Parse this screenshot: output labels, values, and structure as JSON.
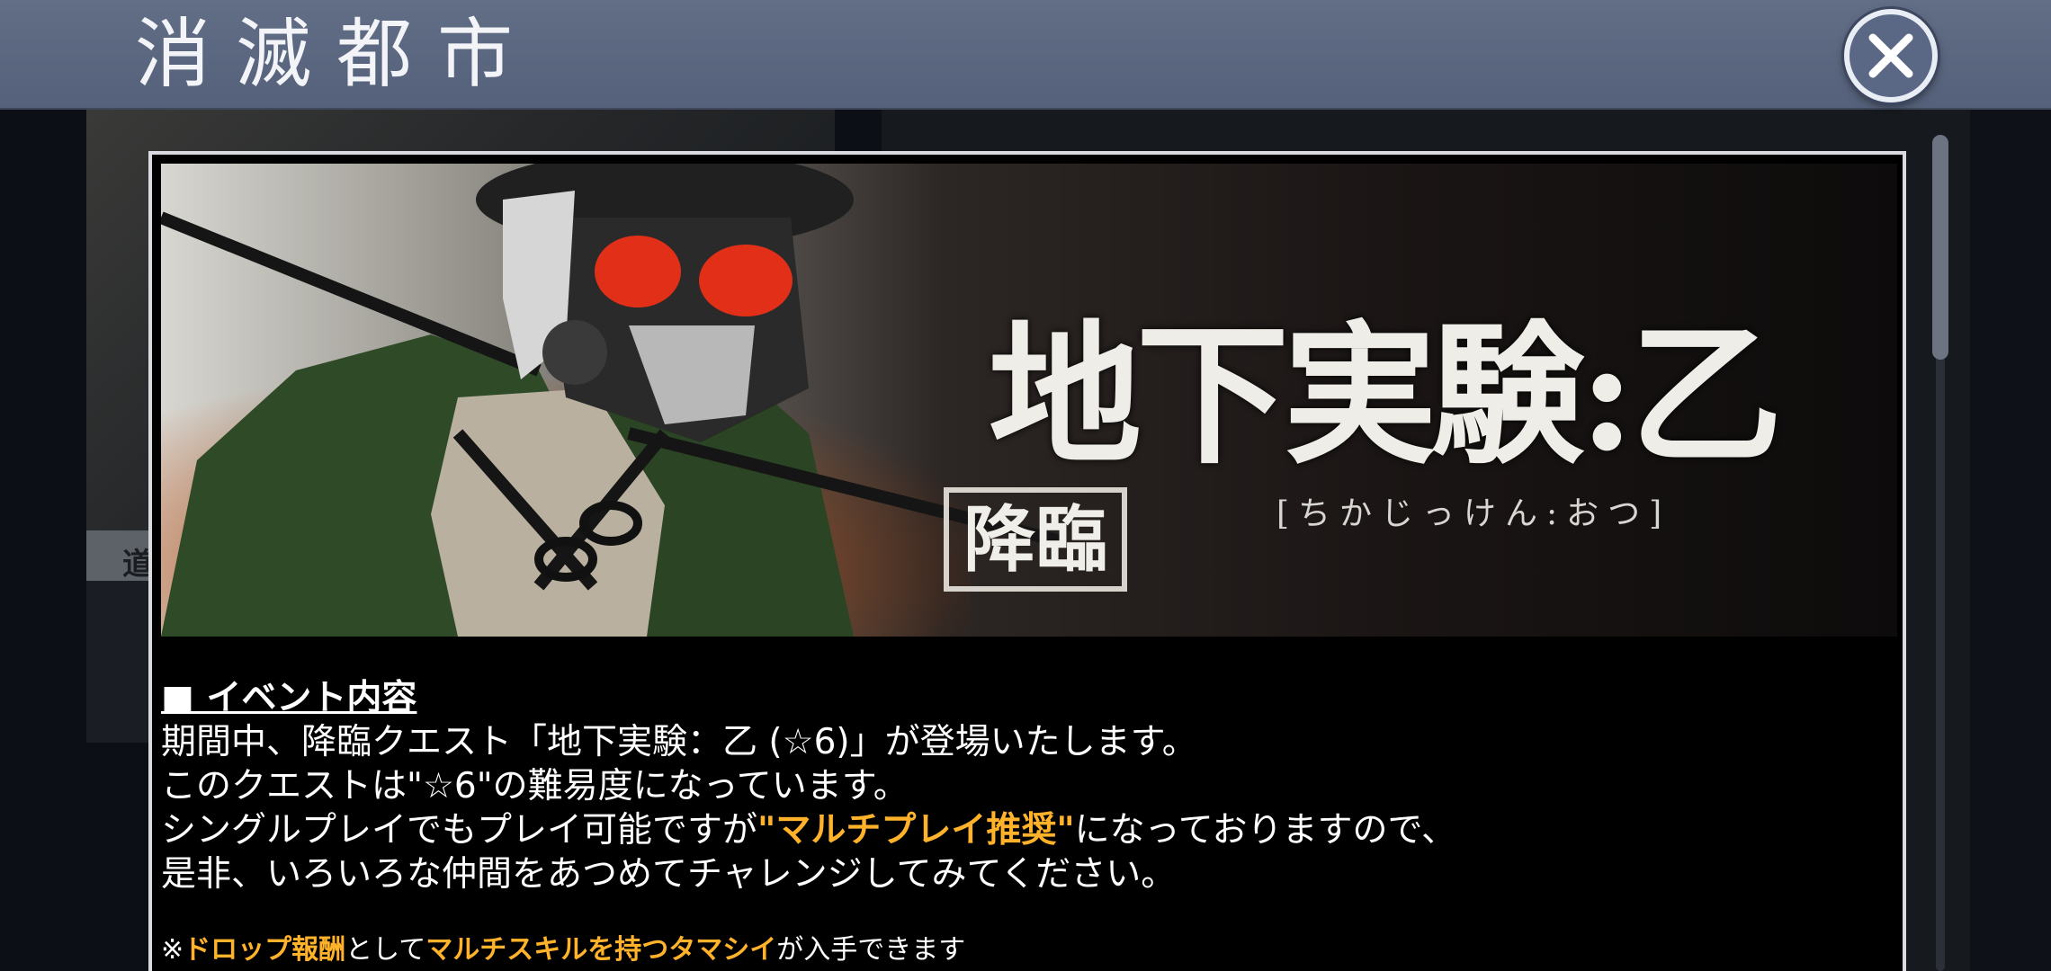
{
  "header": {
    "title": "消滅都市",
    "close_label": "close"
  },
  "background": {
    "strip_text": "道"
  },
  "banner": {
    "title": "地下実験:乙",
    "reading": "[ちかじっけん:おつ]",
    "badge": "降臨"
  },
  "content": {
    "heading": "■ イベント内容",
    "line1": "期間中、降臨クエスト「地下実験：乙 (☆6)」が登場いたします。",
    "line2": "このクエストは\"☆6\"の難易度になっています。",
    "line3_pre": "シングルプレイでもプレイ可能ですが",
    "line3_highlight": "\"マルチプレイ推奨\"",
    "line3_post": "になっておりますので、",
    "line4": "是非、いろいろな仲間をあつめてチャレンジしてみてください。",
    "note_prefix": "※",
    "note_highlight1": "ドロップ報酬",
    "note_mid": "として",
    "note_highlight2": "マルチスキルを持つタマシイ",
    "note_suffix": "が入手できます"
  },
  "colors": {
    "header": "#5d6880",
    "highlight": "#ffb22a",
    "modal_bg": "#000000"
  }
}
